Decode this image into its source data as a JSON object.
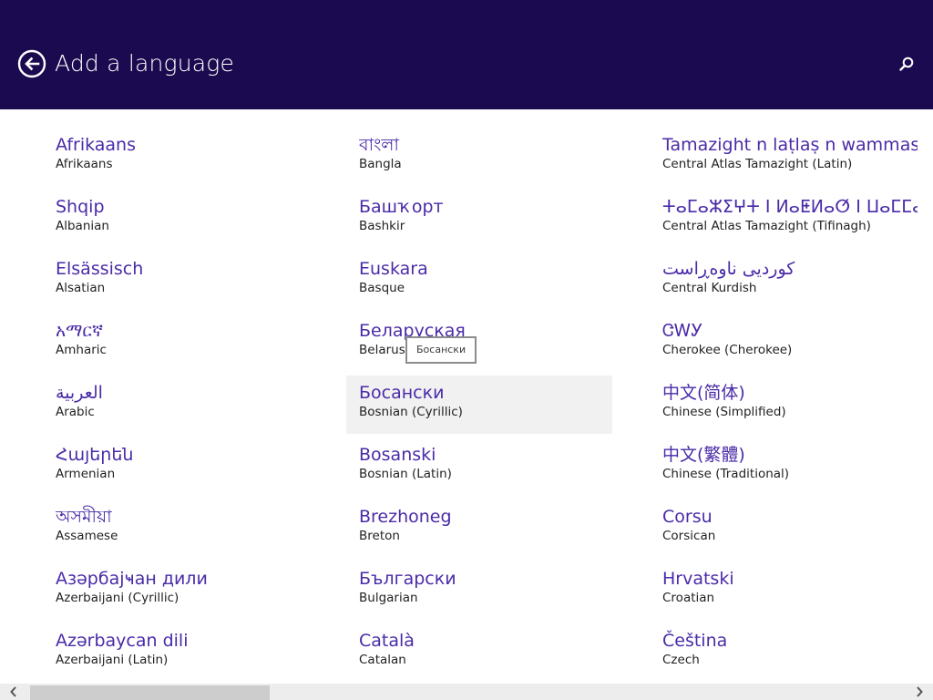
{
  "header": {
    "title": "Add a language",
    "background_color": "#1b0a4f",
    "back_icon": "back-arrow-circle-icon",
    "search_icon": "search-icon"
  },
  "languages": {
    "col1": [
      {
        "native": "Afrikaans",
        "english": "Afrikaans"
      },
      {
        "native": "Shqip",
        "english": "Albanian"
      },
      {
        "native": "Elsässisch",
        "english": "Alsatian"
      },
      {
        "native": "አማርኛ",
        "english": "Amharic"
      },
      {
        "native": "العربية",
        "english": "Arabic"
      },
      {
        "native": "Հայերեն",
        "english": "Armenian"
      },
      {
        "native": "অসমীয়া",
        "english": "Assamese"
      },
      {
        "native": "Азәрбајҹан дили",
        "english": "Azerbaijani (Cyrillic)"
      },
      {
        "native": "Azərbaycan dili",
        "english": "Azerbaijani (Latin)"
      }
    ],
    "col2": [
      {
        "native": "বাংলা",
        "english": "Bangla"
      },
      {
        "native": "Башҡорт",
        "english": "Bashkir"
      },
      {
        "native": "Euskara",
        "english": "Basque"
      },
      {
        "native": "Беларуская",
        "english": "Belarusian"
      },
      {
        "native": "Босански",
        "english": "Bosnian (Cyrillic)"
      },
      {
        "native": "Bosanski",
        "english": "Bosnian (Latin)"
      },
      {
        "native": "Brezhoneg",
        "english": "Breton"
      },
      {
        "native": "Български",
        "english": "Bulgarian"
      },
      {
        "native": "Català",
        "english": "Catalan"
      }
    ],
    "col3": [
      {
        "native": "Tamazight n laṭlaṣ n wammas",
        "english": "Central Atlas Tamazight (Latin)"
      },
      {
        "native": "ⵜⴰⵎⴰⵣⵉⵖⵜ ⵏ ⵍⴰⵟⵍⴰⵚ ⵏ ⵡⴰⵎⵎⴰⵙ",
        "english": "Central Atlas Tamazight (Tifinagh)"
      },
      {
        "native": "کوردیی ناوەڕاست",
        "english": "Central Kurdish"
      },
      {
        "native": "ᏣᎳᎩ",
        "english": "Cherokee (Cherokee)"
      },
      {
        "native": "中文(简体)",
        "english": "Chinese (Simplified)"
      },
      {
        "native": "中文(繁體)",
        "english": "Chinese (Traditional)"
      },
      {
        "native": "Corsu",
        "english": "Corsican"
      },
      {
        "native": "Hrvatski",
        "english": "Croatian"
      },
      {
        "native": "Čeština",
        "english": "Czech"
      }
    ]
  },
  "tooltip": {
    "text": "Босански"
  },
  "scrollbar": {
    "left_icon": "chevron-left-icon",
    "right_icon": "chevron-right-icon",
    "position": 0.0,
    "visible_fraction": 0.26
  },
  "colors": {
    "accent": "#4a2ba8",
    "hover_background": "#f1f1f1"
  }
}
